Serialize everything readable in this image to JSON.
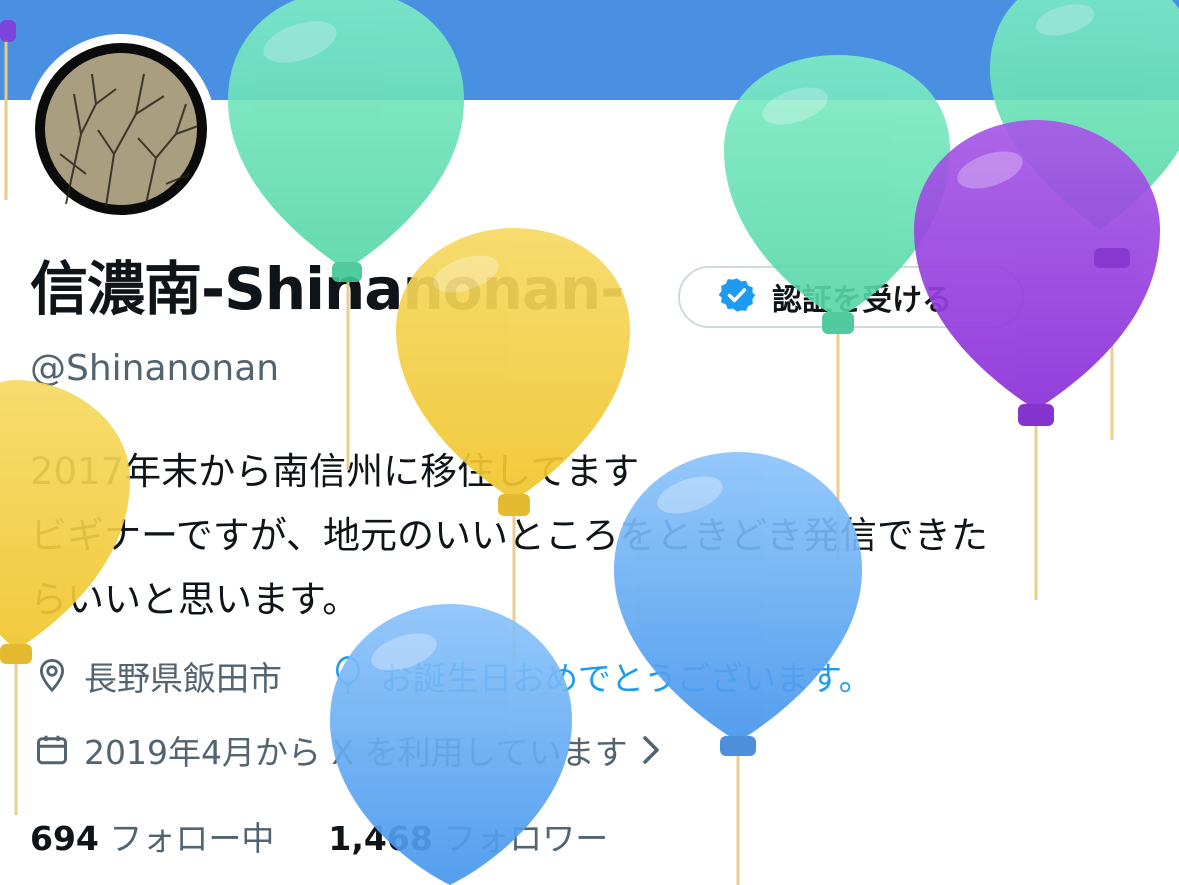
{
  "profile": {
    "display_name": "信濃南-Shinanonan-",
    "handle": "@Shinanonan",
    "verify_button_label": "認証を受ける",
    "bio_lines": [
      "2017年末から南信州に移住してます",
      "ビギナーですが、地元のいいところをときどき発信できた",
      "らいいと思います。"
    ],
    "location": "長野県飯田市",
    "birthday_text": "お誕生日おめでとうございます。",
    "joined": "2019年4月から X を利用しています",
    "following_count": "694",
    "following_label": "フォロー中",
    "followers_count": "1,468",
    "followers_label": "フォロワー"
  },
  "icons": {
    "verify": "verified-badge-icon",
    "location": "location-pin-icon",
    "birthday": "balloon-icon",
    "calendar": "calendar-icon",
    "chevron": "chevron-right-icon"
  },
  "colors": {
    "banner": "#4a90e2",
    "accent": "#1d9bf0",
    "text_primary": "#0f1419",
    "text_secondary": "#536471",
    "balloon_green": "#6fe3bd",
    "balloon_yellow": "#f5cf45",
    "balloon_purple": "#9b3fe0",
    "balloon_blue": "#5aa8f5"
  }
}
